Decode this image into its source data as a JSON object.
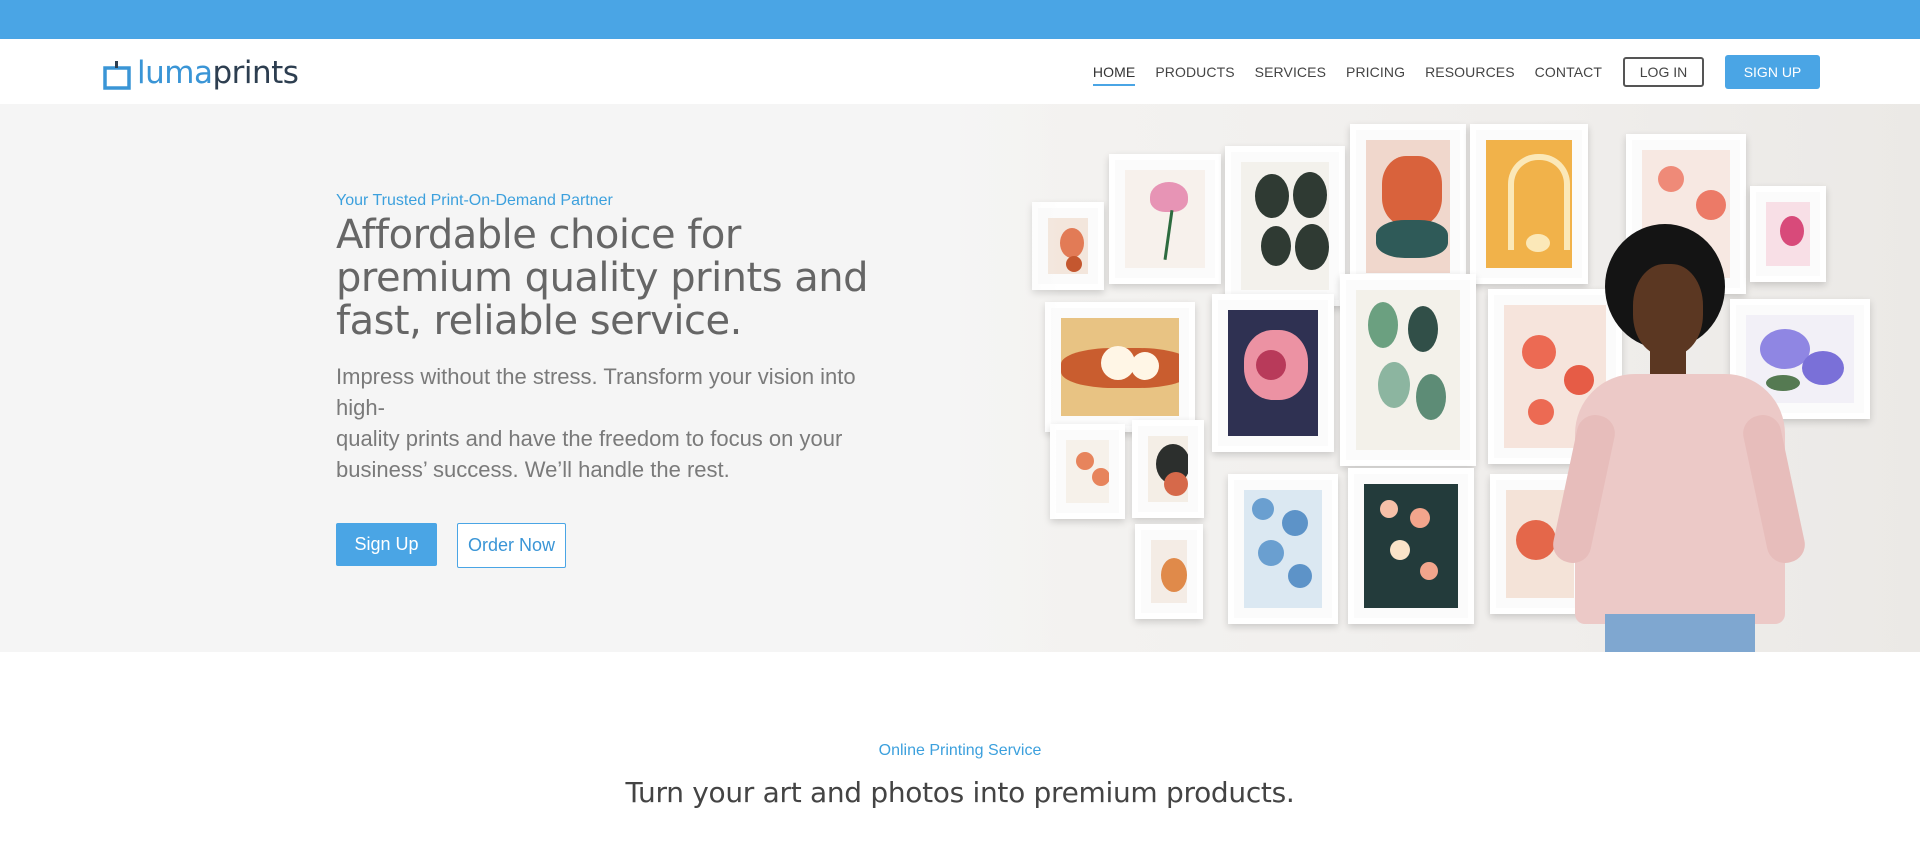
{
  "brand": {
    "logo_part1": "luma",
    "logo_part2": "prints"
  },
  "nav": {
    "items": [
      {
        "label": "HOME",
        "active": true
      },
      {
        "label": "PRODUCTS"
      },
      {
        "label": "SERVICES"
      },
      {
        "label": "PRICING"
      },
      {
        "label": "RESOURCES"
      },
      {
        "label": "CONTACT"
      }
    ],
    "login_label": "LOG IN",
    "signup_label": "SIGN UP"
  },
  "hero": {
    "eyebrow": "Your Trusted Print-On-Demand Partner",
    "headline_line1": "Affordable choice for",
    "headline_line2": "premium quality prints and",
    "headline_line3": "fast, reliable service.",
    "subtext_line1": "Impress without the stress. Transform your vision into high-",
    "subtext_line2": "quality prints and have the freedom to focus on your",
    "subtext_line3": "business’ success. We’ll handle the rest.",
    "primary_button": "Sign Up",
    "secondary_button": "Order Now"
  },
  "section2": {
    "eyebrow": "Online Printing Service",
    "title": "Turn your art and photos into premium products."
  },
  "colors": {
    "accent": "#4aa5e5",
    "topbar": "#4aa5e5",
    "hero_bg": "#f5f5f5"
  }
}
